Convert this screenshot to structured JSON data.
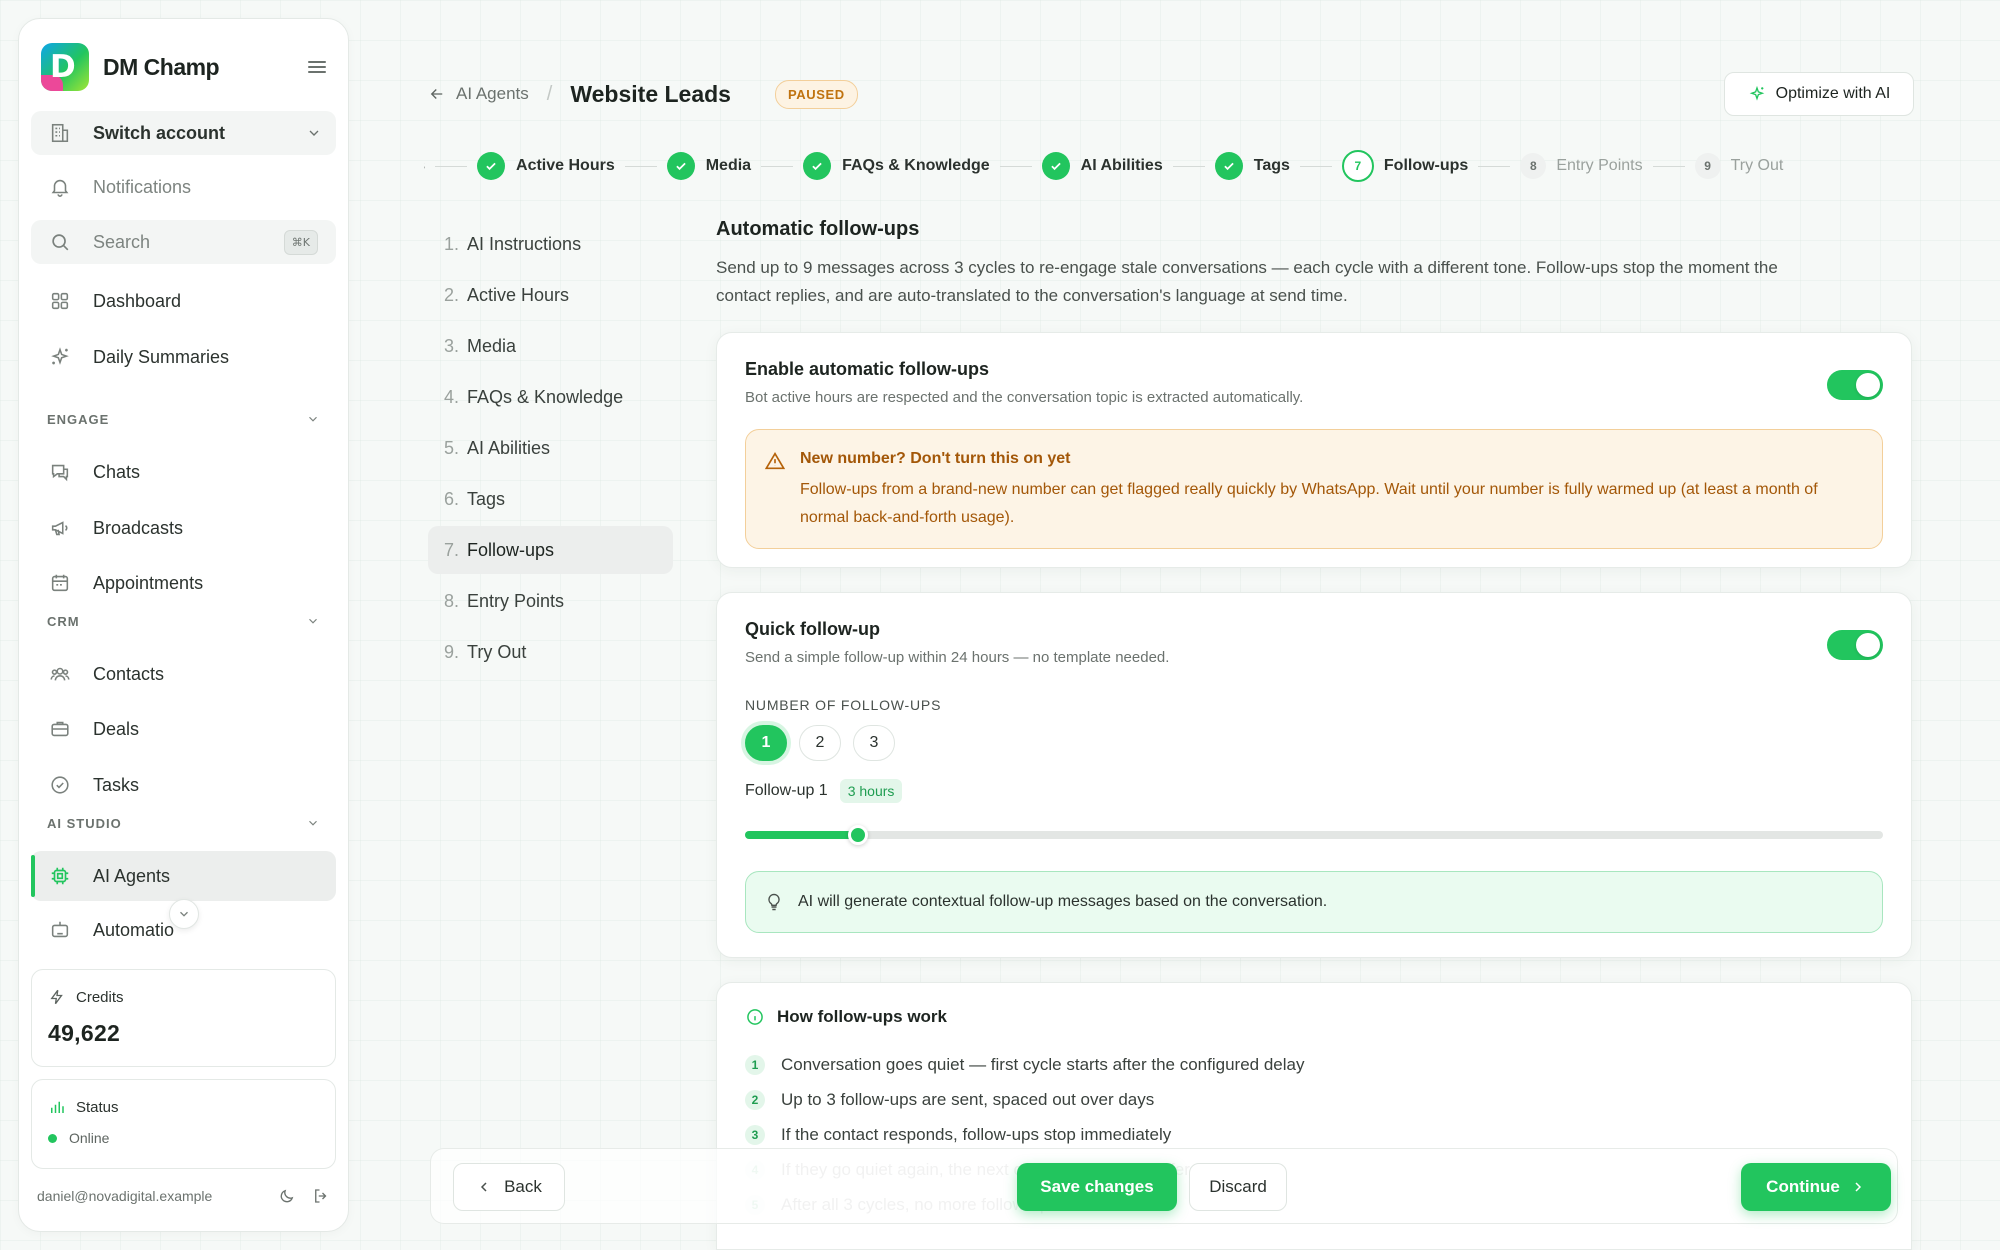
{
  "brand": {
    "name": "DM Champ"
  },
  "sidebar": {
    "switch_account": "Switch account",
    "notifications": "Notifications",
    "search_label": "Search",
    "search_shortcut": "⌘K",
    "dashboard": "Dashboard",
    "daily_summaries": "Daily Summaries",
    "sections": {
      "engage": "ENGAGE",
      "crm": "CRM",
      "ai_studio": "AI STUDIO"
    },
    "engage_items": [
      "Chats",
      "Broadcasts",
      "Appointments"
    ],
    "crm_items": [
      "Contacts",
      "Deals",
      "Tasks"
    ],
    "ai_items": [
      "AI Agents",
      "Automatio"
    ],
    "credits_label": "Credits",
    "credits_value": "49,622",
    "status_label": "Status",
    "status_value": "Online",
    "user_email": "daniel@novadigital.example"
  },
  "header": {
    "breadcrumb_parent": "AI Agents",
    "breadcrumb_sep": "/",
    "title": "Website Leads",
    "status_badge": "PAUSED",
    "optimize_label": "Optimize with AI"
  },
  "stepper": {
    "steps": [
      {
        "label": "AI Instructions",
        "state": "done",
        "num": "1"
      },
      {
        "label": "Active Hours",
        "state": "done",
        "num": "2"
      },
      {
        "label": "Media",
        "state": "done",
        "num": "3"
      },
      {
        "label": "FAQs & Knowledge",
        "state": "done",
        "num": "4"
      },
      {
        "label": "AI Abilities",
        "state": "done",
        "num": "5"
      },
      {
        "label": "Tags",
        "state": "done",
        "num": "6"
      },
      {
        "label": "Follow-ups",
        "state": "current",
        "num": "7"
      },
      {
        "label": "Entry Points",
        "state": "upcoming",
        "num": "8"
      },
      {
        "label": "Try Out",
        "state": "upcoming",
        "num": "9"
      }
    ]
  },
  "steps_list": [
    {
      "num": "1.",
      "label": "AI Instructions"
    },
    {
      "num": "2.",
      "label": "Active Hours"
    },
    {
      "num": "3.",
      "label": "Media"
    },
    {
      "num": "4.",
      "label": "FAQs & Knowledge"
    },
    {
      "num": "5.",
      "label": "AI Abilities"
    },
    {
      "num": "6.",
      "label": "Tags"
    },
    {
      "num": "7.",
      "label": "Follow-ups",
      "active": true
    },
    {
      "num": "8.",
      "label": "Entry Points"
    },
    {
      "num": "9.",
      "label": "Try Out"
    }
  ],
  "main": {
    "title": "Automatic follow-ups",
    "description": "Send up to 9 messages across 3 cycles to re-engage stale conversations — each cycle with a different tone. Follow-ups stop the moment the contact replies, and are auto-translated to the conversation's language at send time.",
    "enable_card": {
      "title": "Enable automatic follow-ups",
      "subtitle": "Bot active hours are respected and the conversation topic is extracted automatically.",
      "enabled": true,
      "warning_title": "New number? Don't turn this on yet",
      "warning_body": "Follow-ups from a brand-new number can get flagged really quickly by WhatsApp. Wait until your number is fully warmed up (at least a month of normal back-and-forth usage)."
    },
    "quick_card": {
      "title": "Quick follow-up",
      "subtitle": "Send a simple follow-up within 24 hours — no template needed.",
      "enabled": true,
      "count_label": "NUMBER OF FOLLOW-UPS",
      "count_options": [
        "1",
        "2",
        "3"
      ],
      "count_selected": "1",
      "followup_label": "Follow-up 1",
      "followup_delay": "3 hours",
      "slider_fraction": 0.099,
      "ai_note": "AI will generate contextual follow-up messages based on the conversation."
    },
    "how_card": {
      "title": "How follow-ups work",
      "items": [
        "Conversation goes quiet — first cycle starts after the configured delay",
        "Up to 3 follow-ups are sent, spaced out over days",
        "If the contact responds, follow-ups stop immediately",
        "If they go quiet again, the next cycle starts with a different tone",
        "After all 3 cycles, no more follow-ups"
      ]
    }
  },
  "actions": {
    "back": "Back",
    "save": "Save changes",
    "discard": "Discard",
    "continue": "Continue"
  },
  "colors": {
    "accent": "#22c55e",
    "warning": "#a35708",
    "warning_bg": "#fdf4e6"
  }
}
